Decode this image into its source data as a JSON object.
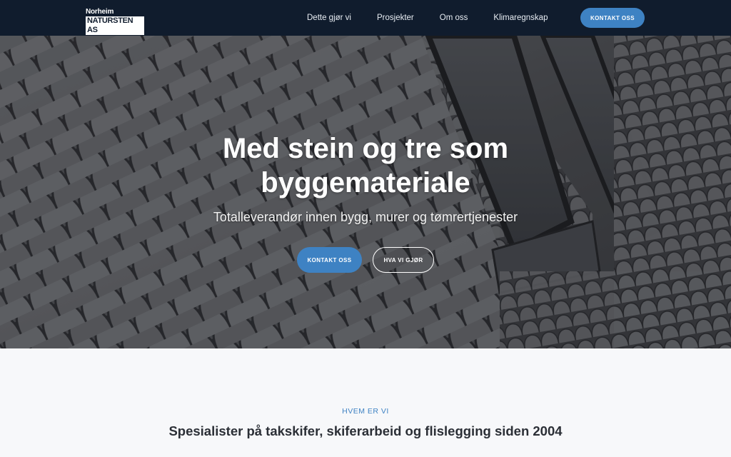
{
  "brand": {
    "logo_line1": "Norheim",
    "logo_line2": "NATURSTEN AS"
  },
  "nav": {
    "items": [
      {
        "label": "Dette gjør vi"
      },
      {
        "label": "Prosjekter"
      },
      {
        "label": "Om oss"
      },
      {
        "label": "Klimaregnskap"
      }
    ],
    "cta_label": "KONTAKT OSS"
  },
  "hero": {
    "title_line1": "Med stein og tre som",
    "title_line2": "byggemateriale",
    "subtitle": "Totalleverandør innen bygg, murer og tømrertjenester",
    "primary_button": "KONTAKT OSS",
    "secondary_button": "HVA VI GJØR"
  },
  "about": {
    "eyebrow": "HVEM ER VI",
    "title": "Spesialister på takskifer, skiferarbeid og flislegging siden 2004"
  },
  "colors": {
    "navbar": "#101c2d",
    "accent": "#3e82c3",
    "section_bg": "#f7f8fa",
    "text_dark": "#2b2f36"
  }
}
